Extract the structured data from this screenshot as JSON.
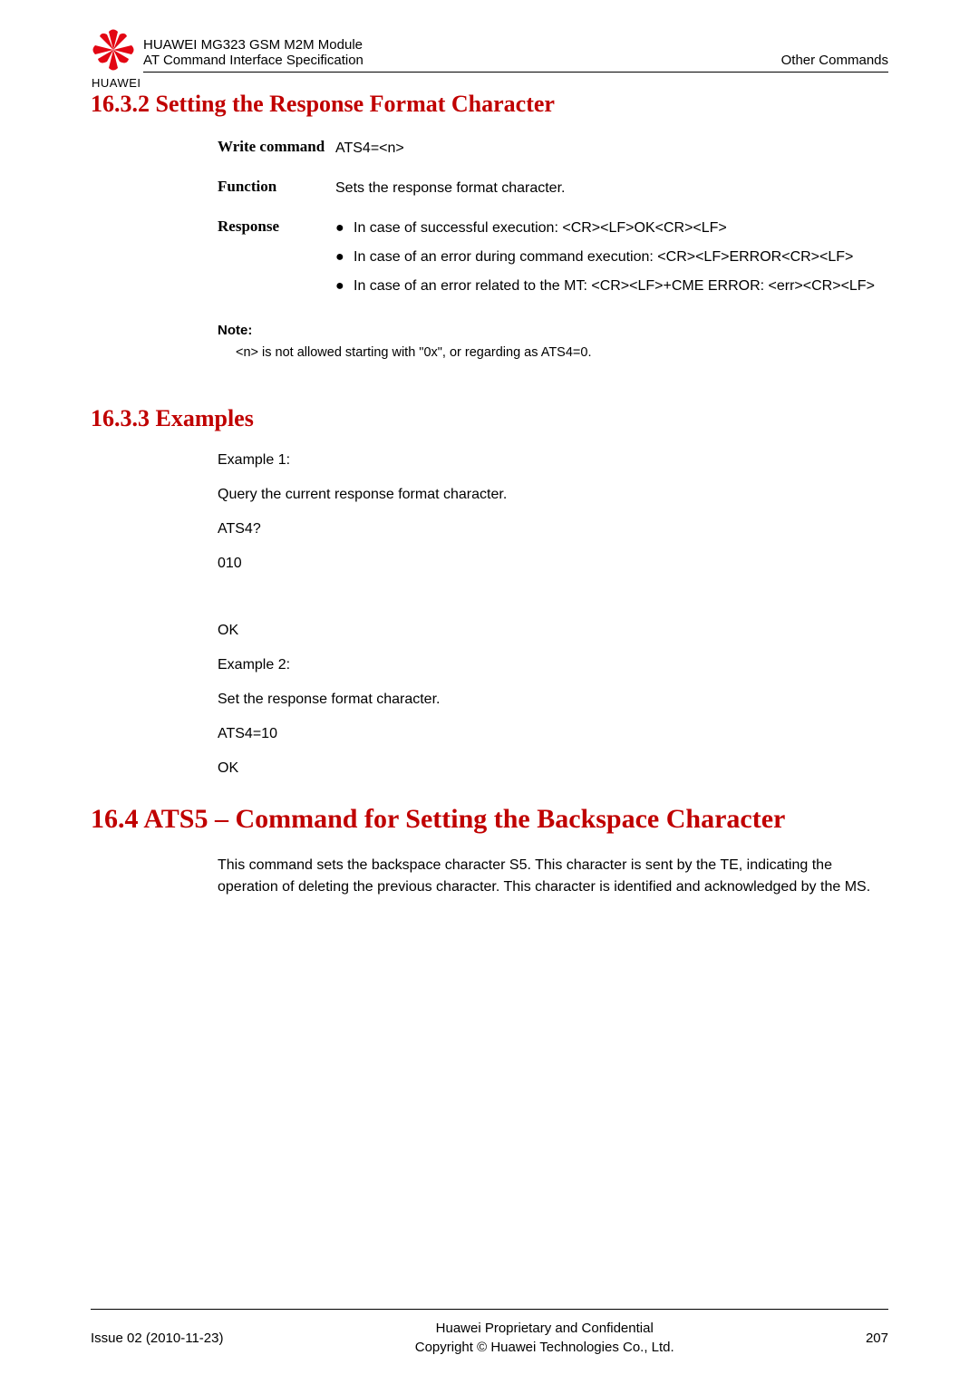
{
  "header": {
    "line1": "HUAWEI MG323 GSM M2M Module",
    "line2": "AT Command Interface Specification",
    "right": "Other Commands",
    "brand": "HUAWEI"
  },
  "section_16_3_2": {
    "title": "16.3.2 Setting the Response Format Character",
    "rows": {
      "write_label": "Write command",
      "write_value": "ATS4=<n>",
      "function_label": "Function",
      "function_value": "Sets the response format character.",
      "response_label": "Response",
      "bullets": [
        "In case of successful execution: <CR><LF>OK<CR><LF>",
        "In case of an error during command execution: <CR><LF>ERROR<CR><LF>",
        "In case of an error related to the MT: <CR><LF>+CME ERROR: <err><CR><LF>"
      ]
    },
    "note_label": "Note:",
    "note_text": "<n> is not allowed starting with    \"0x\", or regarding as ATS4=0."
  },
  "section_16_3_3": {
    "title": "16.3.3 Examples",
    "lines": [
      "Example 1:",
      "Query the current response format character.",
      "ATS4?",
      "010",
      "",
      "OK",
      "Example 2:",
      "Set the response format character.",
      "ATS4=10",
      "OK"
    ]
  },
  "section_16_4": {
    "title": "16.4 ATS5 – Command for Setting the Backspace Character",
    "para": "This command sets the backspace character S5. This character is sent by the TE, indicating the operation of deleting the previous character. This character is identified and acknowledged by the MS."
  },
  "footer": {
    "left": "Issue 02 (2010-11-23)",
    "center1": "Huawei Proprietary and Confidential",
    "center2": "Copyright © Huawei Technologies Co., Ltd.",
    "right": "207"
  }
}
